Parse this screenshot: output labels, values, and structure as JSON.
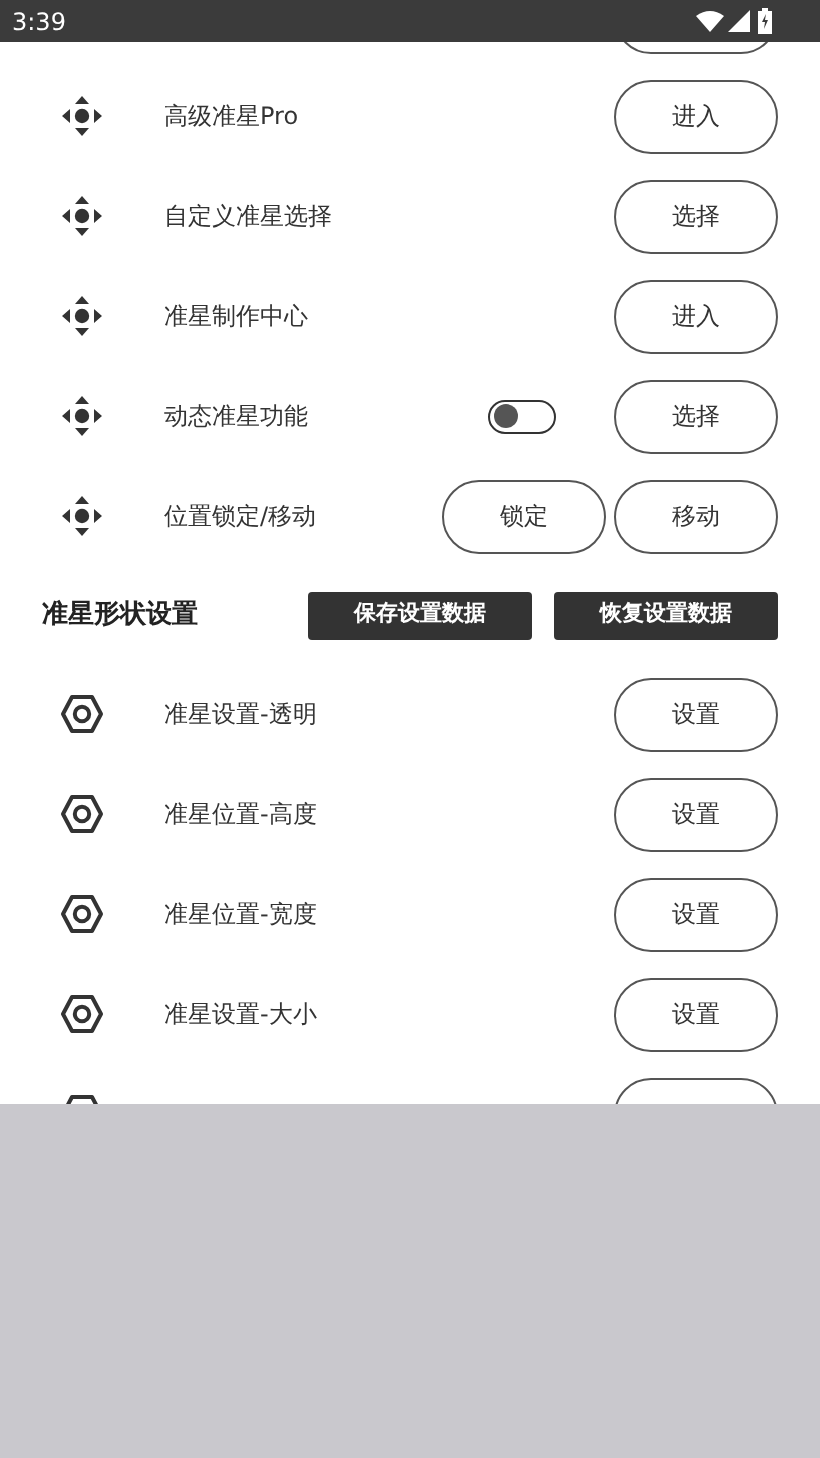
{
  "status_bar": {
    "time": "3:39"
  },
  "top_rows": [
    {
      "kind": "button",
      "label": "高级准星Pro",
      "button": "进入"
    },
    {
      "kind": "button",
      "label": "自定义准星选择",
      "button": "选择"
    },
    {
      "kind": "button",
      "label": "准星制作中心",
      "button": "进入"
    },
    {
      "kind": "toggle",
      "label": "动态准星功能",
      "on": false,
      "button": "选择"
    },
    {
      "kind": "pair",
      "label": "位置锁定/移动",
      "buttons": [
        "锁定",
        "移动"
      ]
    }
  ],
  "shape_section": {
    "title": "准星形状设置",
    "actions": [
      "保存设置数据",
      "恢复设置数据"
    ]
  },
  "shape_rows": [
    {
      "kind": "button",
      "label": "准星设置-透明",
      "button": "设置"
    },
    {
      "kind": "button",
      "label": "准星位置-高度",
      "button": "设置"
    },
    {
      "kind": "button",
      "label": "准星位置-宽度",
      "button": "设置"
    },
    {
      "kind": "button",
      "label": "准星设置-大小",
      "button": "设置"
    },
    {
      "kind": "cut"
    }
  ]
}
